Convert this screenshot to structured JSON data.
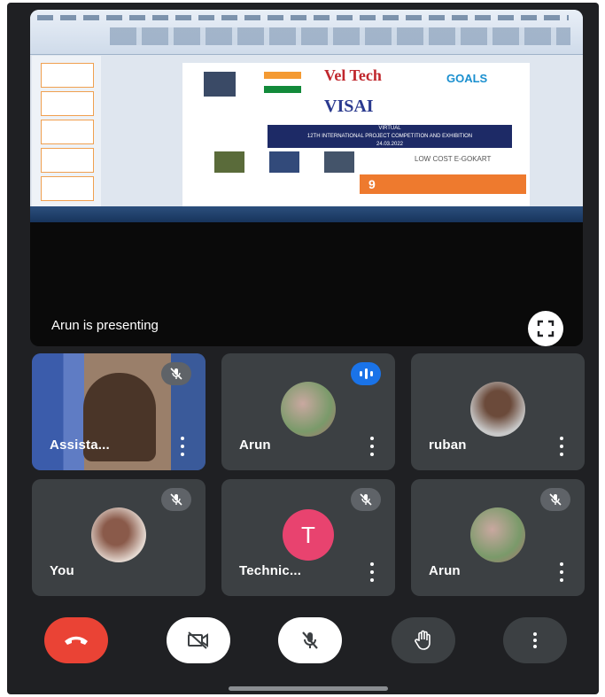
{
  "presentation": {
    "banner_text": "Arun is presenting",
    "slide": {
      "org_title": "Vel Tech",
      "event_title": "VISAI",
      "band_line1": "VIRTUAL",
      "band_line2": "12TH INTERNATIONAL PROJECT COMPETITION AND EXHIBITION",
      "band_line3": "24.03.2022",
      "sdg_label": "GOALS",
      "project_title": "LOW COST E-GOKART",
      "sdg_number": "9"
    }
  },
  "participants": [
    {
      "name": "Assista...",
      "muted": true,
      "avatar": "video"
    },
    {
      "name": "Arun",
      "speaking": true,
      "avatar": "photo"
    },
    {
      "name": "ruban",
      "muted": false,
      "avatar": "photo"
    },
    {
      "name": "You",
      "muted": true,
      "avatar": "photo"
    },
    {
      "name": "Technic...",
      "muted": true,
      "avatar": "T",
      "avatar_color": "#e8436f"
    },
    {
      "name": "Arun",
      "muted": true,
      "avatar": "photo"
    }
  ],
  "controls": {
    "end_call_color": "#ea4335",
    "items": [
      "end-call",
      "camera-off",
      "mic-off",
      "raise-hand",
      "more-options"
    ]
  }
}
